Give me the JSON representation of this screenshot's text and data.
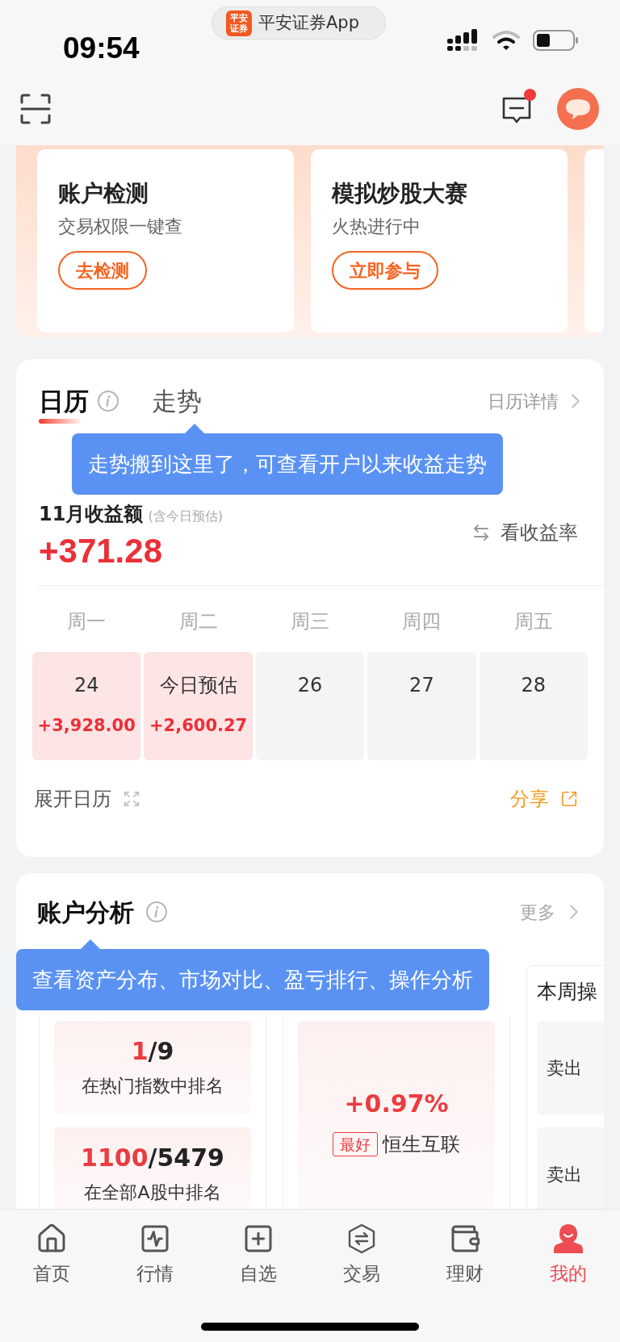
{
  "status_bar": {
    "time": "09:54",
    "app_badge": [
      "平安",
      "证券"
    ],
    "app_name": "平安证券App"
  },
  "header": {
    "unread": true
  },
  "promo_cards": [
    {
      "kind": "card",
      "title": "账户检测",
      "subtitle": "交易权限一键查",
      "button": "去检测"
    },
    {
      "kind": "card",
      "title": "模拟炒股大赛",
      "subtitle": "火热进行中",
      "button": "立即参与"
    },
    {
      "kind": "cut_off"
    }
  ],
  "calendar": {
    "tabs": [
      {
        "label": "日历",
        "selected": true
      },
      {
        "label": "走势",
        "selected": false
      }
    ],
    "detail_link": "日历详情",
    "tooltip": "走势搬到这里了，可查看开户以来收益走势",
    "month_label": "11月收益额",
    "month_note": "(含今日预估)",
    "total": "+371.28",
    "toggle": "看收益率",
    "weekdays": [
      "周一",
      "周二",
      "周三",
      "周四",
      "周五"
    ],
    "days": [
      {
        "label": "24",
        "value": "+3,928.00",
        "has_gain": true
      },
      {
        "label": "今日预估",
        "value": "+2,600.27",
        "has_gain": true
      },
      {
        "label": "26",
        "has_gain": false
      },
      {
        "label": "27",
        "has_gain": false
      },
      {
        "label": "28",
        "has_gain": false
      }
    ],
    "expand": "展开日历",
    "share": "分享"
  },
  "analysis": {
    "title": "账户分析",
    "more": "更多",
    "tooltip": "查看资产分布、市场对比、盈亏排行、操作分析",
    "panels": [
      {
        "kind": "ranks",
        "items": [
          {
            "rank": "1",
            "total": "/9",
            "caption": "在热门指数中排名"
          },
          {
            "rank": "1100",
            "total": "/5479",
            "caption": "在全部A股中排名"
          }
        ]
      },
      {
        "kind": "best",
        "change": "+0.97%",
        "badge": "最好",
        "name": "恒生互联"
      },
      {
        "kind": "actions",
        "title": "本周操",
        "items": [
          "卖出",
          "卖出"
        ]
      }
    ]
  },
  "tab_bar": [
    {
      "label": "首页",
      "selected": false
    },
    {
      "label": "行情",
      "selected": false
    },
    {
      "label": "自选",
      "selected": false
    },
    {
      "label": "交易",
      "selected": false
    },
    {
      "label": "理财",
      "selected": false
    },
    {
      "label": "我的",
      "selected": true
    }
  ]
}
